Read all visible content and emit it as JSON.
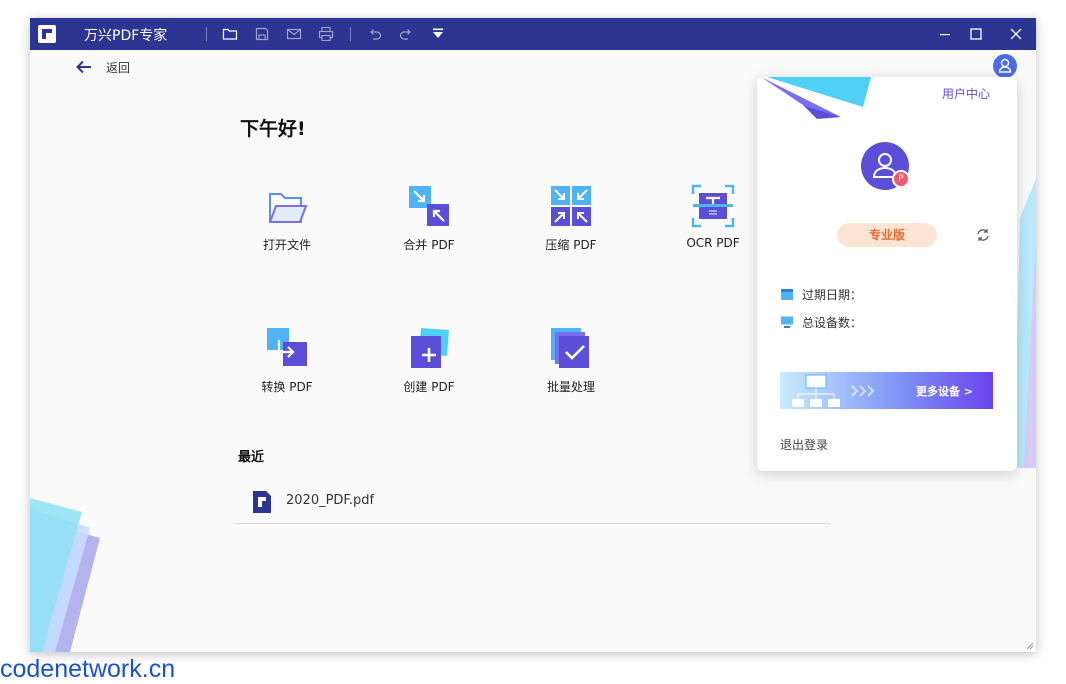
{
  "titlebar": {
    "app_title": "万兴PDF专家",
    "toolbar_icons": [
      "folder-icon",
      "save-icon",
      "mail-icon",
      "print-icon",
      "undo-icon",
      "redo-icon",
      "dropdown-icon"
    ],
    "window_controls": [
      "minimize-icon",
      "maximize-icon",
      "close-icon"
    ]
  },
  "nav": {
    "back_label": "返回"
  },
  "main": {
    "greeting": "下午好!",
    "tools": [
      {
        "label": "打开文件",
        "icon": "folder-open-icon"
      },
      {
        "label": "合并 PDF",
        "icon": "merge-pdf-icon"
      },
      {
        "label": "压缩 PDF",
        "icon": "compress-pdf-icon"
      },
      {
        "label": "OCR PDF",
        "icon": "ocr-pdf-icon"
      },
      {
        "label": "转换 PDF",
        "icon": "convert-pdf-icon"
      },
      {
        "label": "创建 PDF",
        "icon": "create-pdf-icon"
      },
      {
        "label": "批量处理",
        "icon": "batch-process-icon"
      }
    ],
    "recent": {
      "title": "最近",
      "files": [
        {
          "name": "2020_PDF.pdf",
          "icon": "pdf-file-icon"
        }
      ]
    }
  },
  "user_popup": {
    "user_center_link": "用户中心",
    "plan_badge": "专业版",
    "avatar_badge": "P",
    "expiry_label": "过期日期：",
    "devices_label": "总设备数：",
    "banner_label": "更多设备 >",
    "logout_label": "退出登录"
  },
  "watermark": "codenetwork.cn",
  "colors": {
    "titlebar": "#2c3591",
    "accent": "#5a4fd6",
    "pro_badge_bg": "#fde4d4",
    "pro_badge_text": "#e76b2d"
  }
}
